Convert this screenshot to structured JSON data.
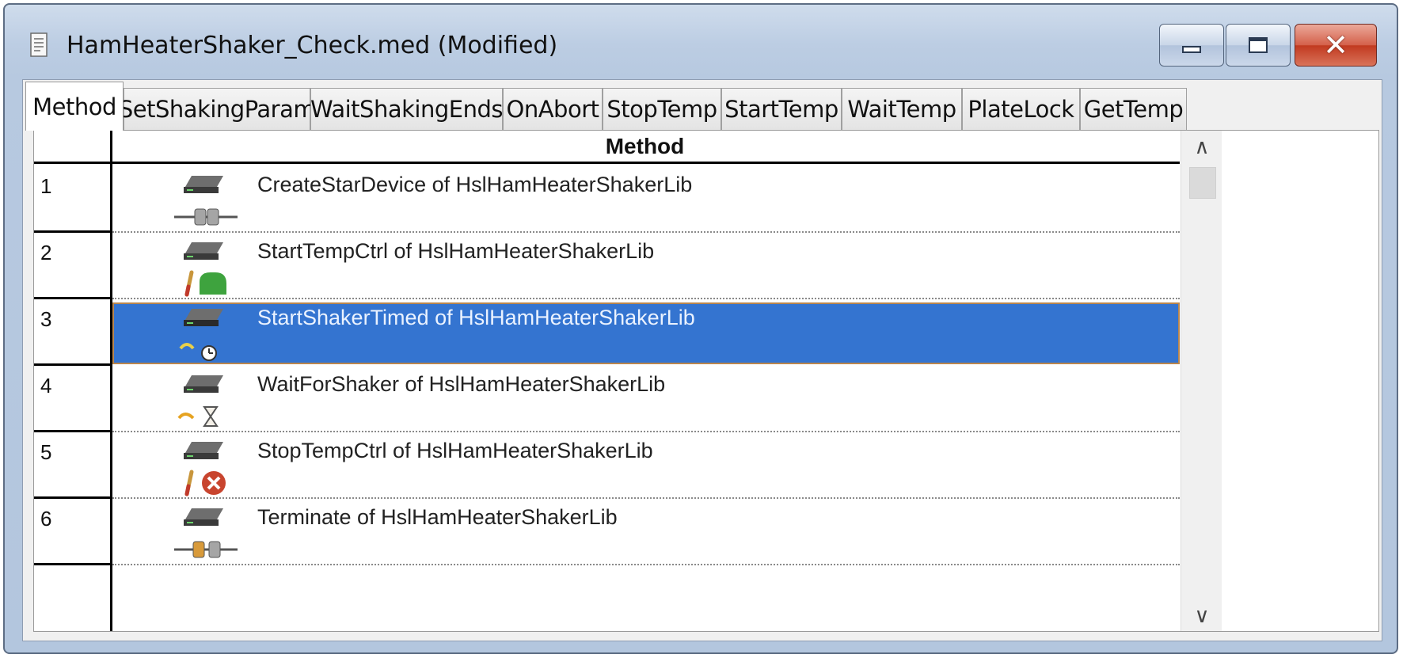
{
  "window": {
    "title": "HamHeaterShaker_Check.med (Modified)",
    "min_icon": "minimize-icon",
    "max_icon": "maximize-icon",
    "close_icon": "close-icon",
    "close_glyph": "✕"
  },
  "tabs": [
    {
      "label": "Method",
      "active": true
    },
    {
      "label": "SetShakingParam"
    },
    {
      "label": "WaitShakingEnds"
    },
    {
      "label": "OnAbort"
    },
    {
      "label": "StopTemp"
    },
    {
      "label": "StartTemp"
    },
    {
      "label": "WaitTemp"
    },
    {
      "label": "PlateLock"
    },
    {
      "label": "GetTemp"
    }
  ],
  "grid": {
    "header": "Method",
    "rows": [
      {
        "num": "1",
        "text": "CreateStarDevice of HslHamHeaterShakerLib",
        "icon": "device-connect-icon"
      },
      {
        "num": "2",
        "text": "StartTempCtrl of HslHamHeaterShakerLib",
        "icon": "temperature-start-icon"
      },
      {
        "num": "3",
        "text": "StartShakerTimed of HslHamHeaterShakerLib",
        "icon": "shaker-timer-icon",
        "selected": true
      },
      {
        "num": "4",
        "text": "WaitForShaker of HslHamHeaterShakerLib",
        "icon": "shaker-wait-icon"
      },
      {
        "num": "5",
        "text": "StopTempCtrl of HslHamHeaterShakerLib",
        "icon": "temperature-stop-icon"
      },
      {
        "num": "6",
        "text": "Terminate of HslHamHeaterShakerLib",
        "icon": "device-disconnect-icon"
      }
    ]
  },
  "scrollbar": {
    "up_glyph": "∧",
    "down_glyph": "∨"
  },
  "colors": {
    "selection": "#3474d0",
    "title_gradient_top": "#cfdcec",
    "close_button": "#c1391f"
  }
}
